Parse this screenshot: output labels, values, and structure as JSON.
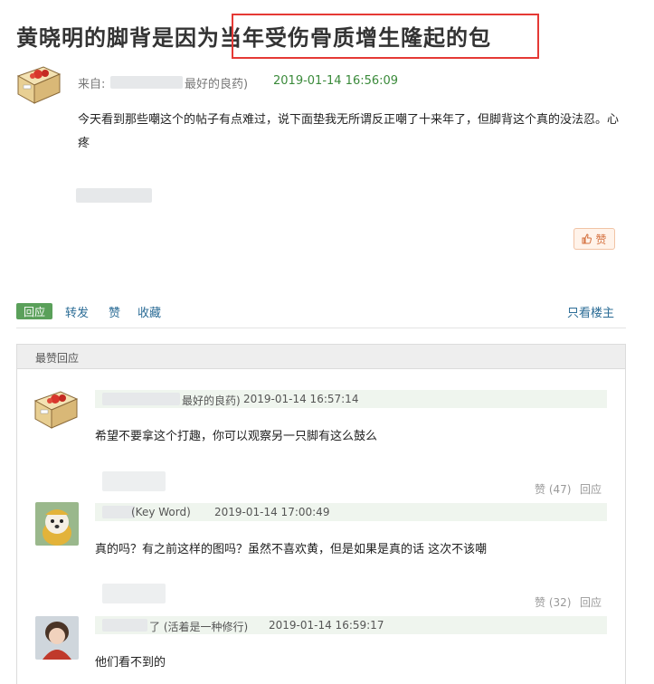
{
  "post": {
    "title_prefix": "黄晓明的脚背是因为",
    "title_highlight": "当年受伤骨质增生隆起的包",
    "from_label": "来自:",
    "source_suffix": "最好的良药)",
    "date": "2019-01-14 16:56:09",
    "body": "今天看到那些嘲这个的帖子有点难过，说下面垫我无所谓反正嘲了十来年了，但脚背这个真的没法忍。心疼",
    "like_label": "赞"
  },
  "actions": {
    "reply": "回应",
    "forward": "转发",
    "like": "赞",
    "collect": "收藏",
    "only_op": "只看楼主"
  },
  "hot_replies": {
    "title": "最赞回应",
    "comments": [
      {
        "name": "最好的良药)",
        "date": "2019-01-14 16:57:14",
        "text": "希望不要拿这个打趣，你可以观察另一只脚有这么鼓么",
        "likes": "赞 (47)",
        "reply": "回应"
      },
      {
        "name": "(Key Word)",
        "date": "2019-01-14 17:00:49",
        "text": "真的吗？有之前这样的图吗？虽然不喜欢黄，但是如果是真的话 这次不该嘲",
        "likes": "赞 (32)",
        "reply": "回应"
      },
      {
        "name": "了 (活着是一种修行)",
        "date": "2019-01-14 16:59:17",
        "text": "他们看不到的"
      }
    ]
  },
  "colors": {
    "accent_green": "#5aa05a",
    "date_green": "#3a8a3a",
    "link_blue": "#2b6c96",
    "highlight_red": "#e53935"
  }
}
